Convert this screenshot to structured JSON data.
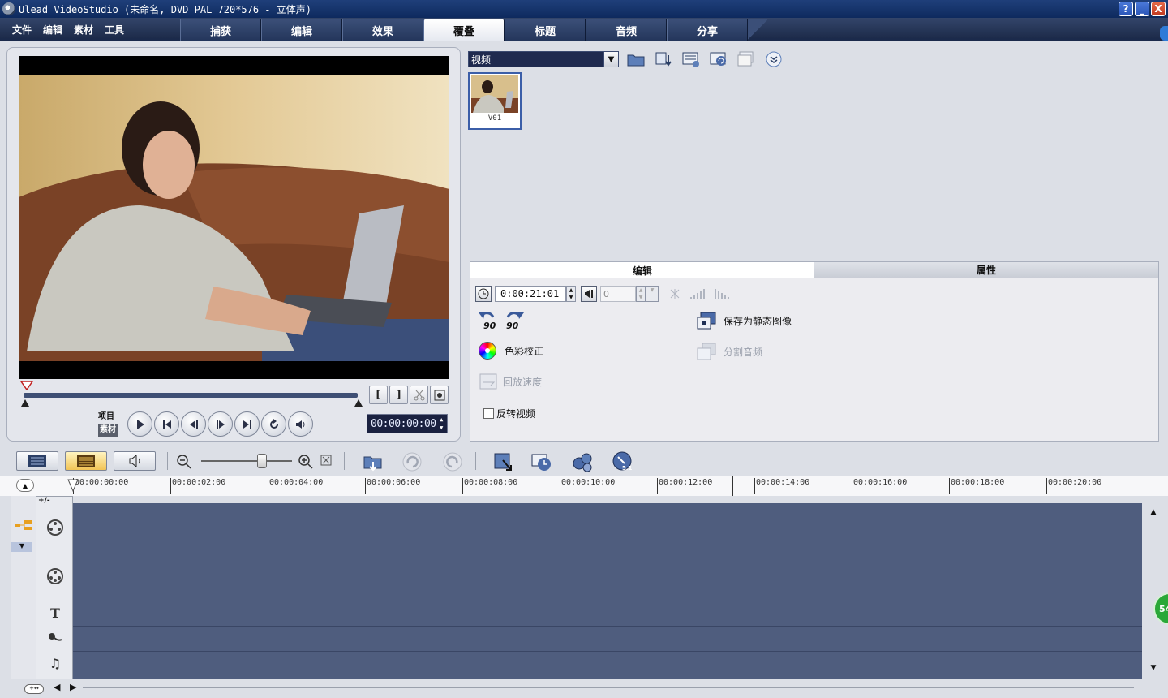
{
  "window": {
    "title": "Ulead VideoStudio (未命名, DVD PAL 720*576 - 立体声)",
    "buttons": [
      "?",
      "_",
      "X"
    ]
  },
  "menu": [
    "文件",
    "编辑",
    "素材",
    "工具"
  ],
  "steps": [
    {
      "label": "捕获",
      "active": false
    },
    {
      "label": "编辑",
      "active": false
    },
    {
      "label": "效果",
      "active": false
    },
    {
      "label": "覆叠",
      "active": true
    },
    {
      "label": "标题",
      "active": false
    },
    {
      "label": "音频",
      "active": false
    },
    {
      "label": "分享",
      "active": false
    }
  ],
  "preview": {
    "mode_project": "项目",
    "mode_clip": "素材",
    "timecode": "00:00:00:00",
    "mark_in": "[",
    "mark_out": "]"
  },
  "library": {
    "category": "视频",
    "clips": [
      {
        "label": "V01"
      }
    ]
  },
  "options": {
    "tabs": [
      {
        "label": "编辑",
        "active": true
      },
      {
        "label": "属性",
        "active": false
      }
    ],
    "duration": "0:00:21:01",
    "volume": "0",
    "save_still": "保存为静态图像",
    "color_correction": "色彩校正",
    "split_audio": "分割音频",
    "playback_speed": "回放速度",
    "reverse_video": "反转视频",
    "rotate_left": "90",
    "rotate_right": "90"
  },
  "timeline": {
    "ruler": [
      "00:00:00:00",
      "00:00:02:00",
      "00:00:04:00",
      "00:00:06:00",
      "00:00:08:00",
      "00:00:10:00",
      "00:00:12:00",
      "00:00:14:00",
      "00:00:16:00",
      "00:00:18:00",
      "00:00:20:00"
    ],
    "tracks": [
      "video-track-icon",
      "overlay-track-icon",
      "title-track-icon",
      "voice-track-icon",
      "music-track-icon"
    ],
    "plus_minus": "+/-",
    "badge": "54"
  },
  "colors": {
    "accent": "#24365b",
    "track_bg": "#4f5d7e",
    "active_view": "#f2c456"
  }
}
